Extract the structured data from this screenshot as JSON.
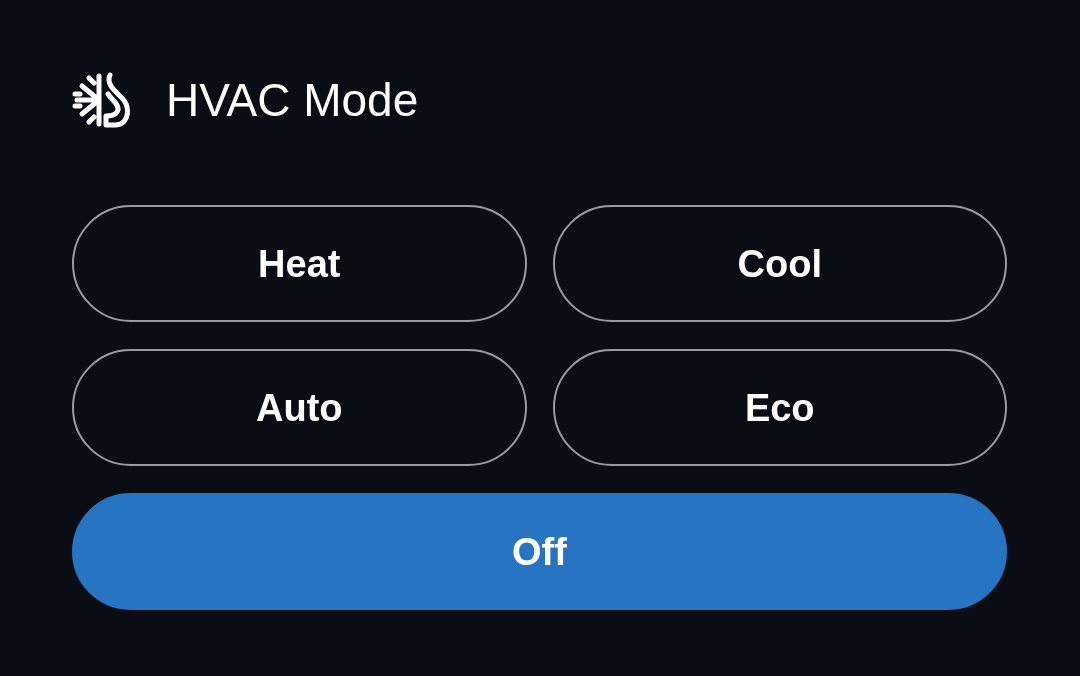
{
  "title": "HVAC Mode",
  "modes": [
    {
      "label": "Heat",
      "selected": false
    },
    {
      "label": "Cool",
      "selected": false
    },
    {
      "label": "Auto",
      "selected": false
    },
    {
      "label": "Eco",
      "selected": false
    },
    {
      "label": "Off",
      "selected": true
    }
  ]
}
